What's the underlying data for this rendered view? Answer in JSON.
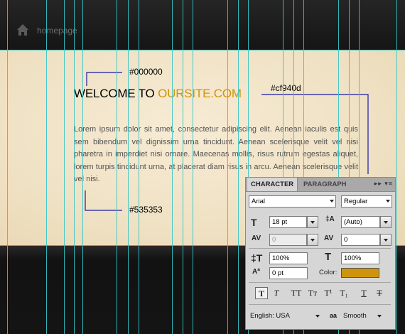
{
  "nav": {
    "home_icon": "home-icon",
    "home_label": "homepage"
  },
  "content": {
    "welcome_text": "WELCOME TO ",
    "welcome_accent": "OURSITE.COM",
    "body_text": "Lorem ipsum dolor sit amet, consectetur adipiscing elit. Aenean iaculis est quis sem bibendum vel dignissim urna tincidunt. Aenean scelerisque velit vel nisi pharetra in imperdiet nisi ornare. Maecenas mollis, risus rutrum egestas aliquet, lorem turpis tincidunt urna, at placerat diam risus in arcu. Aenean scelerisque velit vel nisi."
  },
  "annotations": {
    "heading_color": "#000000",
    "accent_color": "#cf940d",
    "body_color": "#535353"
  },
  "colors": {
    "guide": "#35c6c9",
    "annotation_line": "#1a1aa6",
    "accent": "#cf940d"
  },
  "panel": {
    "tabs": [
      "CHARACTER",
      "PARAGRAPH"
    ],
    "tab_controls": "▸▸ ▾≡",
    "font_family": "Arial",
    "font_style": "Regular",
    "font_size": "18 pt",
    "leading": "(Auto)",
    "kerning": "0",
    "tracking": "0",
    "vertical_scale": "100%",
    "horizontal_scale": "100%",
    "baseline_shift": "0 pt",
    "color_label": "Color:",
    "style_buttons": [
      "T",
      "T",
      "TT",
      "Tт",
      "T¹",
      "T₁",
      "T",
      "T"
    ],
    "language": "English: USA",
    "antialias_icon": "aa",
    "antialias": "Smooth"
  }
}
